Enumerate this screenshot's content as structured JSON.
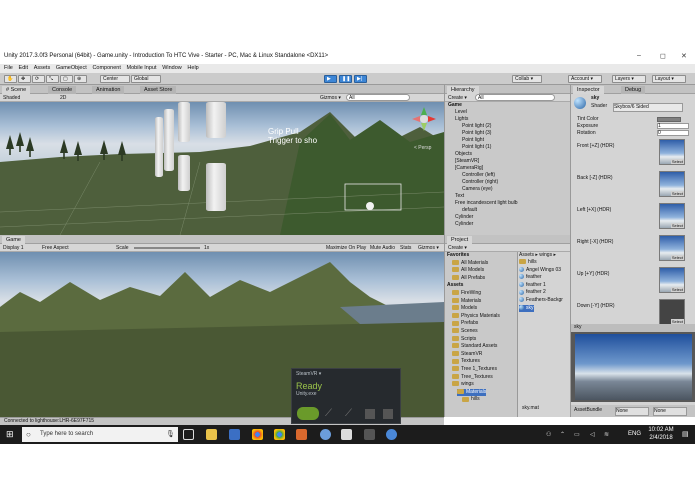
{
  "window": {
    "title": "Unity 2017.3.0f3 Personal (64bit) - Game.unity - Introduction To HTC Vive - Starter - PC, Mac & Linux Standalone <DX11>",
    "min_glyph": "–",
    "max_glyph": "◻",
    "close_glyph": "✕"
  },
  "menu": [
    "File",
    "Edit",
    "Assets",
    "GameObject",
    "Component",
    "Mobile Input",
    "Window",
    "Help"
  ],
  "toolbar": {
    "pivot": "Center",
    "space": "Global",
    "collab": "Collab ▾",
    "account": "Account ▾",
    "layers": "Layers ▾",
    "layout": "Layout ▾"
  },
  "scene": {
    "tabs": [
      "# Scene",
      "Console",
      "Animation",
      "Asset Store"
    ],
    "shading": "Shaded",
    "mode2d": "2D",
    "gizmos": "Gizmos ▾",
    "search": "All",
    "overlay_lines": [
      "Grip Pull",
      "Trigger to sho"
    ],
    "persp": "< Persp"
  },
  "game": {
    "tab": "Game",
    "display": "Display 1",
    "aspect": "Free Aspect",
    "scale_label": "Scale",
    "scale_value": "1x",
    "options": [
      "Maximize On Play",
      "Mute Audio",
      "Stats",
      "Gizmos ▾"
    ]
  },
  "hierarchy": {
    "tab": "Hierarchy",
    "create": "Create ▾",
    "search": "All",
    "items": [
      {
        "label": "Game",
        "indent": 0,
        "bold": true
      },
      {
        "label": "Level",
        "indent": 1
      },
      {
        "label": "Lights",
        "indent": 1
      },
      {
        "label": "Point light (2)",
        "indent": 2
      },
      {
        "label": "Point light (3)",
        "indent": 2
      },
      {
        "label": "Point light",
        "indent": 2
      },
      {
        "label": "Point light (1)",
        "indent": 2
      },
      {
        "label": "Objects",
        "indent": 1
      },
      {
        "label": "[SteamVR]",
        "indent": 1
      },
      {
        "label": "[CameraRig]",
        "indent": 1
      },
      {
        "label": "Controller (left)",
        "indent": 2
      },
      {
        "label": "Controller (right)",
        "indent": 2
      },
      {
        "label": "Camera (eye)",
        "indent": 2
      },
      {
        "label": "Text",
        "indent": 1
      },
      {
        "label": "Free incandescent light bulb",
        "indent": 1
      },
      {
        "label": "default",
        "indent": 2
      },
      {
        "label": "Cylinder",
        "indent": 1
      },
      {
        "label": "Cylinder",
        "indent": 1
      }
    ]
  },
  "project": {
    "tab": "Project",
    "create": "Create ▾",
    "tree": [
      {
        "label": "Favorites",
        "indent": 0,
        "bold": true
      },
      {
        "label": "All Materials",
        "indent": 1
      },
      {
        "label": "All Models",
        "indent": 1
      },
      {
        "label": "All Prefabs",
        "indent": 1
      },
      {
        "label": "Assets",
        "indent": 0,
        "bold": true
      },
      {
        "label": "FireWing",
        "indent": 1
      },
      {
        "label": "Materials",
        "indent": 1
      },
      {
        "label": "Models",
        "indent": 1
      },
      {
        "label": "Physics Materials",
        "indent": 1
      },
      {
        "label": "Prefabs",
        "indent": 1
      },
      {
        "label": "Scenes",
        "indent": 1
      },
      {
        "label": "Scripts",
        "indent": 1
      },
      {
        "label": "Standard Assets",
        "indent": 1
      },
      {
        "label": "SteamVR",
        "indent": 1
      },
      {
        "label": "Textures",
        "indent": 1
      },
      {
        "label": "Tree 1_Textures",
        "indent": 1
      },
      {
        "label": "Tree_Textures",
        "indent": 1
      },
      {
        "label": "wings",
        "indent": 1
      },
      {
        "label": "Materials",
        "indent": 2,
        "sel": true
      },
      {
        "label": "hills",
        "indent": 3
      }
    ],
    "breadcrumb": "Assets ▸ wings ▸",
    "files": [
      "hills",
      "Angel Wings 03",
      "feather",
      "feather 1",
      "feather 2",
      "Feathers-Backgr",
      "sky"
    ],
    "footer": "sky.mat"
  },
  "inspector": {
    "tabs": [
      "Inspector",
      "Debug"
    ],
    "object_name": "sky",
    "shader_label": "Shader",
    "shader_value": "Skybox/6 Sided",
    "props": [
      {
        "label": "Tint Color",
        "value": ""
      },
      {
        "label": "Exposure",
        "value": "1"
      },
      {
        "label": "Rotation",
        "value": "0"
      }
    ],
    "textures": [
      "Front [+Z]   (HDR)",
      "Back [-Z]   (HDR)",
      "Left [+X]   (HDR)",
      "Right [-X]   (HDR)",
      "Up [+Y]   (HDR)",
      "Down [-Y]   (HDR)"
    ],
    "select_label": "Select",
    "preview_title": "sky",
    "assetbundle_label": "AssetBundle",
    "assetbundle_value": "None",
    "variant_value": "None"
  },
  "status": {
    "text": "Connected to lighthouse:LHR-6E97F715"
  },
  "steamvr": {
    "title": "SteamVR ▾",
    "status": "Ready",
    "subtitle": "Unity.exe"
  },
  "taskbar": {
    "search_placeholder": "Type here to search",
    "time": "10:02 AM",
    "date": "2/4/2018",
    "lang": "ENG"
  },
  "colors": {
    "accent": "#3d6fbf",
    "play": "#3d86d6",
    "taskbar": "#1c1c1c",
    "steam_green": "#9bc44a"
  }
}
